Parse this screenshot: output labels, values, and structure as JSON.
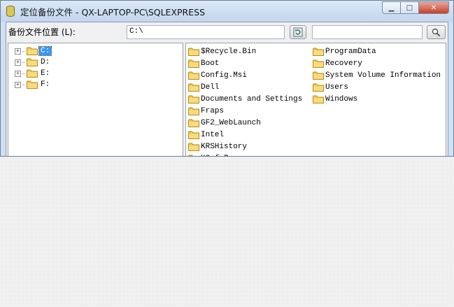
{
  "window": {
    "title": "定位备份文件 - QX-LAPTOP-PC\\SQLEXPRESS",
    "minimize_glyph": "▁",
    "maximize_glyph": "□",
    "close_glyph": "✕"
  },
  "path_bar": {
    "label": "备份文件位置 (L):",
    "value": "C:\\",
    "search_value": ""
  },
  "drives": [
    {
      "label": "C:",
      "selected": true
    },
    {
      "label": "D:",
      "selected": false
    },
    {
      "label": "E:",
      "selected": false
    },
    {
      "label": "F:",
      "selected": false
    }
  ],
  "folders_col1": [
    "$Recycle.Bin",
    "Boot",
    "Config.Msi",
    "Dell",
    "Documents and Settings",
    "Fraps",
    "GF2_WebLaunch",
    "Intel",
    "KRSHistory",
    "KSafeR"
  ],
  "folders_col2": [
    "ProgramData",
    "Recovery",
    "System Volume Information",
    "Users",
    "Windows"
  ],
  "colors": {
    "folder": "#f2c94c",
    "selection": "#3399ff",
    "title_gradient_top": "#dbe8f7"
  },
  "icons": {
    "app": "database-icon",
    "refresh": "refresh-icon",
    "search": "search-icon",
    "folder": "folder-icon",
    "expand": "plus-expander-icon"
  }
}
